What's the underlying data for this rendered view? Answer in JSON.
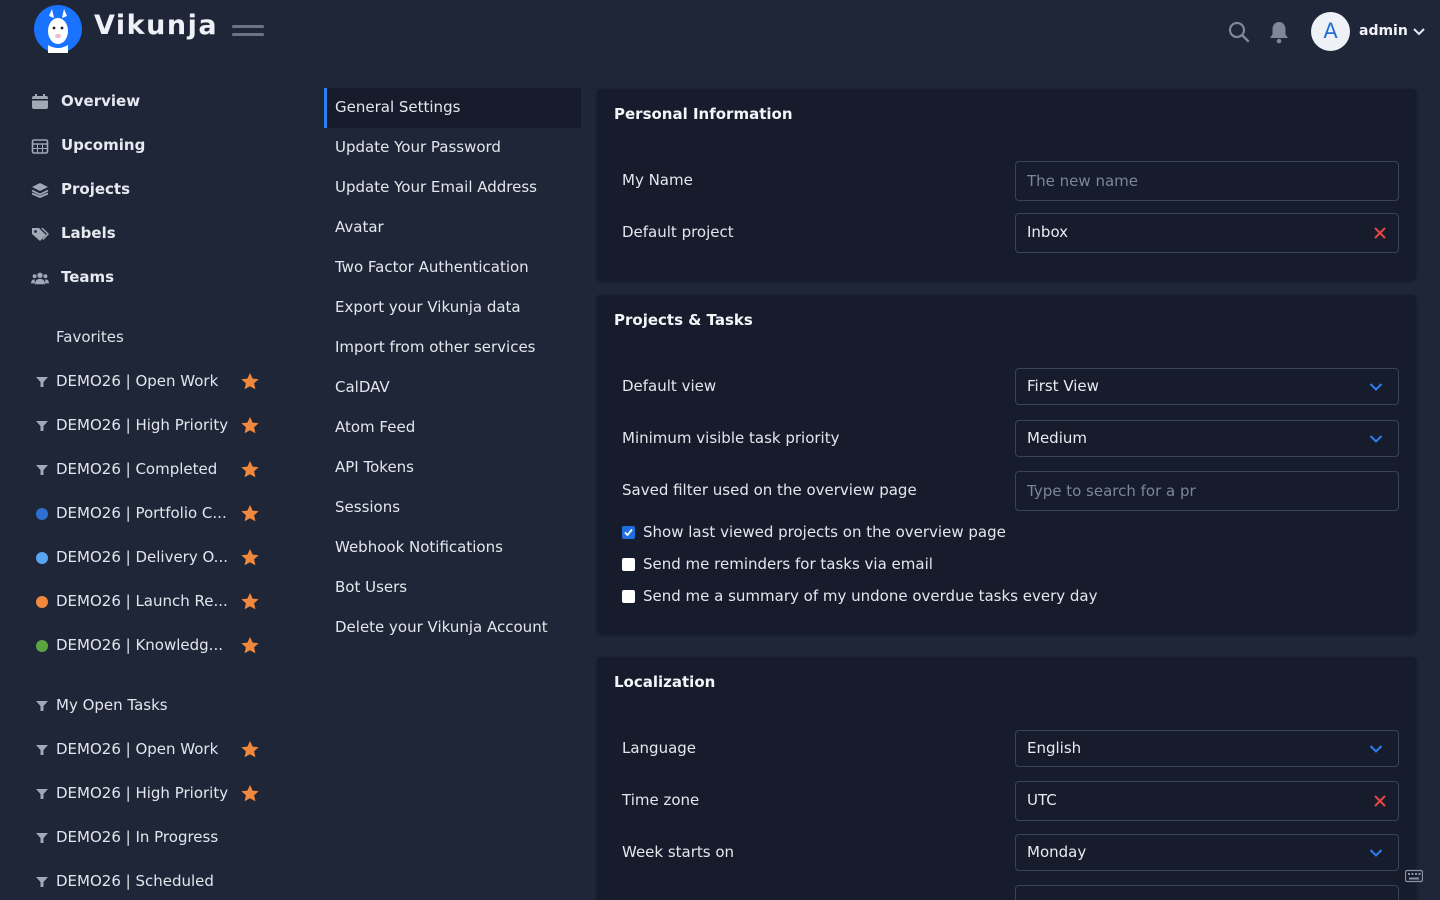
{
  "app": {
    "name": "Vikunja"
  },
  "user": {
    "initial": "A",
    "name": "admin"
  },
  "nav": {
    "items": [
      {
        "label": "Overview",
        "icon": "calendar-icon"
      },
      {
        "label": "Upcoming",
        "icon": "calendar-grid-icon"
      },
      {
        "label": "Projects",
        "icon": "layers-icon"
      },
      {
        "label": "Labels",
        "icon": "tags-icon"
      },
      {
        "label": "Teams",
        "icon": "users-icon"
      }
    ]
  },
  "projects": {
    "favorites_title": "Favorites",
    "favorites": [
      {
        "label": "DEMO26 | Open Work",
        "kind": "filter"
      },
      {
        "label": "DEMO26 | High Priority",
        "kind": "filter"
      },
      {
        "label": "DEMO26 | Completed",
        "kind": "filter"
      },
      {
        "label": "DEMO26 | Portfolio C...",
        "kind": "project",
        "color": "#2f6fd1"
      },
      {
        "label": "DEMO26 | Delivery O...",
        "kind": "project",
        "color": "#58a6f0"
      },
      {
        "label": "DEMO26 | Launch Re...",
        "kind": "project",
        "color": "#f0883e"
      },
      {
        "label": "DEMO26 | Knowledg...",
        "kind": "project",
        "color": "#5aa540"
      }
    ],
    "filters_title": "My Open Tasks",
    "filters": [
      {
        "label": "DEMO26 | Open Work",
        "starred": true
      },
      {
        "label": "DEMO26 | High Priority",
        "starred": true
      },
      {
        "label": "DEMO26 | In Progress",
        "starred": false
      },
      {
        "label": "DEMO26 | Scheduled",
        "starred": false
      }
    ],
    "star_color": "#f0883e"
  },
  "settings_menu": [
    "General Settings",
    "Update Your Password",
    "Update Your Email Address",
    "Avatar",
    "Two Factor Authentication",
    "Export your Vikunja data",
    "Import from other services",
    "CalDAV",
    "Atom Feed",
    "API Tokens",
    "Sessions",
    "Webhook Notifications",
    "Bot Users",
    "Delete your Vikunja Account"
  ],
  "personal": {
    "title": "Personal Information",
    "name_label": "My Name",
    "name_placeholder": "The new name",
    "default_project_label": "Default project",
    "default_project_value": "Inbox"
  },
  "projects_tasks": {
    "title": "Projects & Tasks",
    "default_view_label": "Default view",
    "default_view_value": "First View",
    "min_priority_label": "Minimum visible task priority",
    "min_priority_value": "Medium",
    "saved_filter_label": "Saved filter used on the overview page",
    "saved_filter_placeholder": "Type to search for a pr",
    "checkboxes": [
      {
        "label": "Show last viewed projects on the overview page",
        "checked": true
      },
      {
        "label": "Send me reminders for tasks via email",
        "checked": false
      },
      {
        "label": "Send me a summary of my undone overdue tasks every day",
        "checked": false
      }
    ]
  },
  "localization": {
    "title": "Localization",
    "language_label": "Language",
    "language_value": "English",
    "timezone_label": "Time zone",
    "timezone_value": "UTC",
    "week_start_label": "Week starts on",
    "week_start_value": "Monday"
  },
  "colors": {
    "accent": "#1f6fe0",
    "clear": "#e64646",
    "star": "#f0883e"
  }
}
